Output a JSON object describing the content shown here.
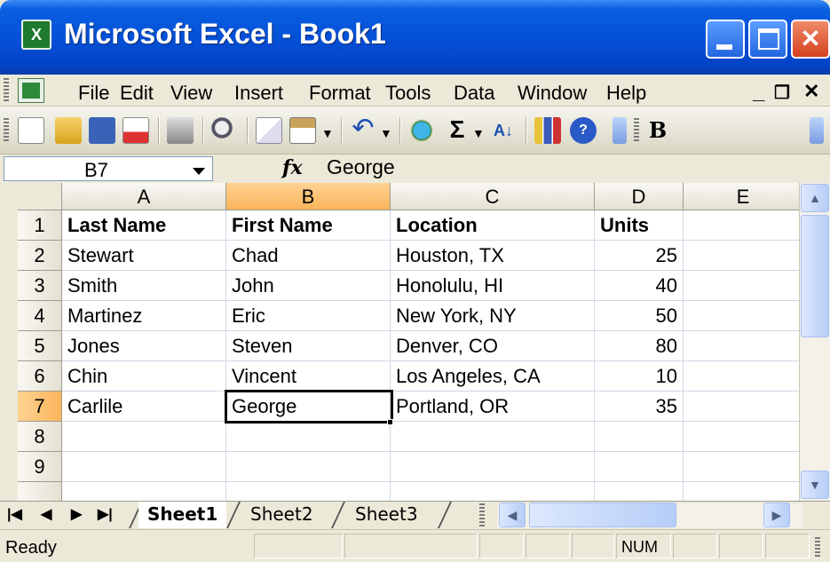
{
  "window": {
    "title": "Microsoft Excel - Book1",
    "app_icon_glyph": "X"
  },
  "menubar": {
    "items": [
      {
        "label": "File"
      },
      {
        "label": "Edit"
      },
      {
        "label": "View"
      },
      {
        "label": "Insert"
      },
      {
        "label": "Format"
      },
      {
        "label": "Tools"
      },
      {
        "label": "Data"
      },
      {
        "label": "Window"
      },
      {
        "label": "Help"
      }
    ]
  },
  "toolbar": {
    "icons": [
      "new-icon",
      "open-icon",
      "save-icon",
      "permission-icon",
      "print-icon",
      "research-icon",
      "copy-icon",
      "paste-icon",
      "undo-icon",
      "hyperlink-icon",
      "autosum-icon",
      "sort-ascending-icon",
      "chart-wizard-icon",
      "help-icon",
      "bold-icon"
    ],
    "autosum_label": "Σ",
    "sort_label": "A↓",
    "bold_label": "B"
  },
  "formulabar": {
    "name_box": "B7",
    "fx_label": "fx",
    "formula": "George"
  },
  "grid": {
    "columns": [
      "A",
      "B",
      "C",
      "D",
      "E"
    ],
    "rows": [
      "1",
      "2",
      "3",
      "4",
      "5",
      "6",
      "7",
      "8",
      "9"
    ],
    "header_row": [
      "Last Name",
      "First Name",
      "Location",
      "Units"
    ],
    "data": [
      [
        "Stewart",
        "Chad",
        "Houston, TX",
        "25"
      ],
      [
        "Smith",
        "John",
        "Honolulu, HI",
        "40"
      ],
      [
        "Martinez",
        "Eric",
        "New York, NY",
        "50"
      ],
      [
        "Jones",
        "Steven",
        "Denver, CO",
        "80"
      ],
      [
        "Chin",
        "Vincent",
        "Los Angeles, CA",
        "10"
      ],
      [
        "Carlile",
        "George",
        "Portland, OR",
        "35"
      ]
    ],
    "active_cell": "B7",
    "selection_color": "#f9b45a"
  },
  "sheets": {
    "tabs": [
      "Sheet1",
      "Sheet2",
      "Sheet3"
    ],
    "active": "Sheet1"
  },
  "statusbar": {
    "status": "Ready",
    "num_lock": "NUM"
  }
}
